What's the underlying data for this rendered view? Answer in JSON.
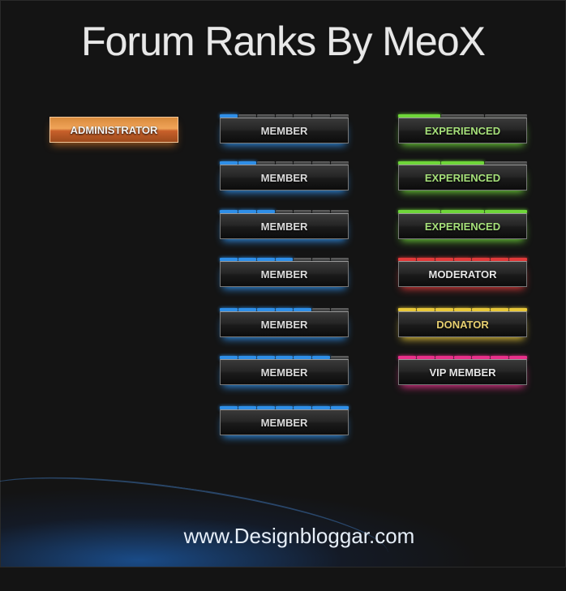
{
  "title": "Forum Ranks By MeoX",
  "footer": "www.Designbloggar.com",
  "colors": {
    "member": "#2f8fe8",
    "experienced": "#6fd63a",
    "moderator": "#e03a3a",
    "donator": "#e8c83a",
    "vip": "#e8308a",
    "admin": "#e88a3a"
  },
  "admin": {
    "label": "ADMINISTRATOR"
  },
  "members": [
    {
      "label": "MEMBER",
      "level": 1,
      "segments": 7
    },
    {
      "label": "MEMBER",
      "level": 2,
      "segments": 7
    },
    {
      "label": "MEMBER",
      "level": 3,
      "segments": 7
    },
    {
      "label": "MEMBER",
      "level": 4,
      "segments": 7
    },
    {
      "label": "MEMBER",
      "level": 5,
      "segments": 7
    },
    {
      "label": "MEMBER",
      "level": 6,
      "segments": 7
    },
    {
      "label": "MEMBER",
      "level": 7,
      "segments": 7
    }
  ],
  "right": [
    {
      "label": "EXPERIENCED",
      "level": 1,
      "segments": 3,
      "color": "#6fd63a",
      "text": "#a6e07a"
    },
    {
      "label": "EXPERIENCED",
      "level": 2,
      "segments": 3,
      "color": "#6fd63a",
      "text": "#a6e07a"
    },
    {
      "label": "EXPERIENCED",
      "level": 3,
      "segments": 3,
      "color": "#6fd63a",
      "text": "#a6e07a"
    },
    {
      "label": "MODERATOR",
      "level": 7,
      "segments": 7,
      "color": "#e03a3a",
      "text": "#e6e6e6"
    },
    {
      "label": "DONATOR",
      "level": 7,
      "segments": 7,
      "color": "#e8c83a",
      "text": "#e8d070"
    },
    {
      "label": "VIP MEMBER",
      "level": 7,
      "segments": 7,
      "color": "#e8308a",
      "text": "#e6e6e6"
    }
  ]
}
